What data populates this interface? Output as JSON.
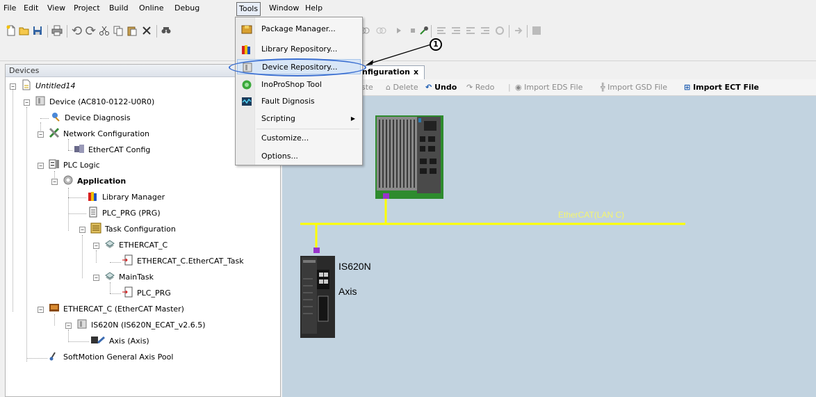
{
  "menubar": {
    "items": [
      "File",
      "Edit",
      "View",
      "Project",
      "Build",
      "Online",
      "Debug",
      "Tools",
      "Window",
      "Help"
    ]
  },
  "tools_menu": {
    "items": [
      {
        "label": "Package Manager...",
        "icon": "package-icon"
      },
      {
        "label": "Library Repository...",
        "icon": "library-icon"
      },
      {
        "label": "Device Repository...",
        "icon": "device-repo-icon"
      },
      {
        "label": "InoProShop Tool",
        "icon": "inoproshop-icon"
      },
      {
        "label": "Fault Dignosis",
        "icon": "fault-icon"
      },
      {
        "label": "Scripting",
        "icon": ""
      },
      {
        "label": "Customize...",
        "icon": ""
      },
      {
        "label": "Options...",
        "icon": ""
      }
    ]
  },
  "callout": {
    "number": "1"
  },
  "devices_panel": {
    "title": "Devices",
    "tree": [
      {
        "label": "Untitled14"
      },
      {
        "label": "Device (AC810-0122-U0R0)"
      },
      {
        "label": "Device Diagnosis"
      },
      {
        "label": "Network Configuration"
      },
      {
        "label": "EtherCAT Config"
      },
      {
        "label": "PLC Logic"
      },
      {
        "label": "Application"
      },
      {
        "label": "Library Manager"
      },
      {
        "label": "PLC_PRG (PRG)"
      },
      {
        "label": "Task Configuration"
      },
      {
        "label": "ETHERCAT_C"
      },
      {
        "label": "ETHERCAT_C.EtherCAT_Task"
      },
      {
        "label": "MainTask"
      },
      {
        "label": "PLC_PRG"
      },
      {
        "label": "ETHERCAT_C (EtherCAT Master)"
      },
      {
        "label": "IS620N (IS620N_ECAT_v2.6.5)"
      },
      {
        "label": "Axis (Axis)"
      },
      {
        "label": "SoftMotion General Axis Pool"
      }
    ]
  },
  "editor": {
    "tab_label": "nfiguration",
    "tab_close": "x",
    "toolbar": {
      "paste": "ste",
      "delete": "Delete",
      "undo": "Undo",
      "redo": "Redo",
      "import_eds": "Import EDS File",
      "import_gsd": "Import GSD File",
      "import_ect": "Import ECT File"
    },
    "network_label": "EtherCAT(LAN C)",
    "slave_name": "IS620N",
    "slave_axis": "Axis"
  },
  "colors": {
    "canvas": "#c2d3e0",
    "bus": "#ffff00",
    "connector": "#9933cc",
    "plc_base": "#2e8b2e"
  }
}
